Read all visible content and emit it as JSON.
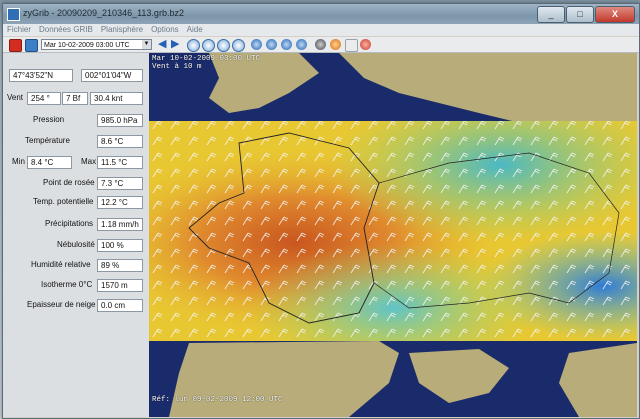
{
  "window": {
    "title": "zyGrib - 20090209_210346_113.grb.bz2",
    "minimize": "_",
    "maximize": "□",
    "close": "X"
  },
  "menu": [
    "Fichier",
    "Données GRIB",
    "Planisphère",
    "Options",
    "Aide"
  ],
  "toolbar": {
    "date_select": "Mar 10-02-2009 03:00 UTC"
  },
  "panel": {
    "latitude": "47°43'52\"N",
    "longitude": "002°01'04\"W",
    "wind_label": "Vent",
    "wind_dir": "254 °",
    "wind_bf": "7 Bf",
    "wind_speed": "30.4 knt",
    "pressure_label": "Pression",
    "pressure": "985.0 hPa",
    "temperature_label": "Température",
    "temperature": "8.6 °C",
    "min_label": "Min",
    "min_value": "8.4 °C",
    "max_label": "Max",
    "max_value": "11.5 °C",
    "dew_label": "Point de rosée",
    "dew_value": "7.3 °C",
    "potential_label": "Temp. potentielle",
    "potential_value": "12.2 °C",
    "precip_label": "Précipitations",
    "precip_value": "1.18 mm/h",
    "cloud_label": "Nébulosité",
    "cloud_value": "100 %",
    "humidity_label": "Humidité relative",
    "humidity_value": "89 %",
    "isotherm_label": "Isotherme 0°C",
    "isotherm_value": "1570 m",
    "snow_label": "Epaisseur de neige",
    "snow_value": "0.0 cm"
  },
  "map": {
    "overlay_top_line1": "Mar 10-02-2009 03:00 UTC",
    "overlay_top_line2": "Vent à 10 m",
    "overlay_bottom": "Réf: lun 09-02-2009 12:00 UTC",
    "colors": {
      "sea": "#1a2b6b",
      "land": "#b8ad7a",
      "warm": "#d9742a",
      "mid": "#e8c832",
      "cool": "#5fc4c8",
      "cold": "#3e86d8"
    }
  }
}
